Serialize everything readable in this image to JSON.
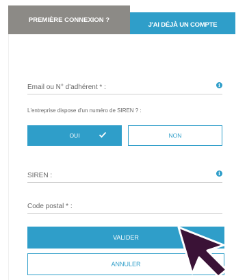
{
  "tabs": {
    "first_login": "PREMIÈRE CONNEXION ?",
    "have_account": "J'AI DÉJÀ UN COMPTE"
  },
  "form": {
    "email_placeholder": "Email ou N° d'adhérent * :",
    "siren_question": "L'entreprise dispose d'un numéro de SIREN ? :",
    "yes_label": "OUI",
    "no_label": "NON",
    "siren_placeholder": "SIREN :",
    "postal_placeholder": "Code postal * :",
    "validate_label": "VALIDER",
    "cancel_label": "ANNULER"
  },
  "colors": {
    "accent": "#2f9ec9",
    "inactive_tab": "#8c8a86",
    "cursor": "#3a1236"
  },
  "icons": {
    "info": "info-icon",
    "check": "check-icon",
    "cursor": "mouse-pointer-icon"
  }
}
